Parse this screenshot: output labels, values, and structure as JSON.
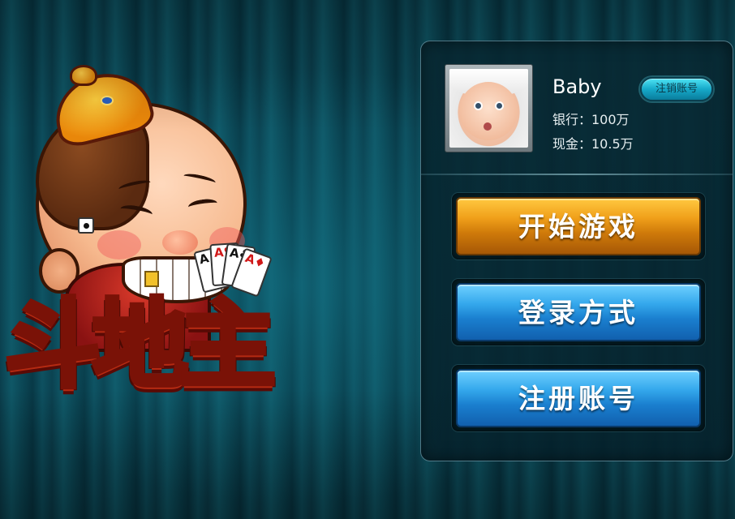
{
  "logo": {
    "title": "斗地主",
    "cards": [
      "A♠",
      "A♥",
      "A♣",
      "A♦"
    ]
  },
  "profile": {
    "username": "Baby",
    "bank": "银行：100万",
    "cash": "现金：10.5万",
    "logout_label": "注销账号"
  },
  "buttons": {
    "start": "开始游戏",
    "login": "登录方式",
    "register": "注册账号"
  },
  "colors": {
    "start_button": "#e08a10",
    "blue_button": "#1a7fcf",
    "logout_button": "#16a9c9",
    "background": "#0a3c4a"
  }
}
